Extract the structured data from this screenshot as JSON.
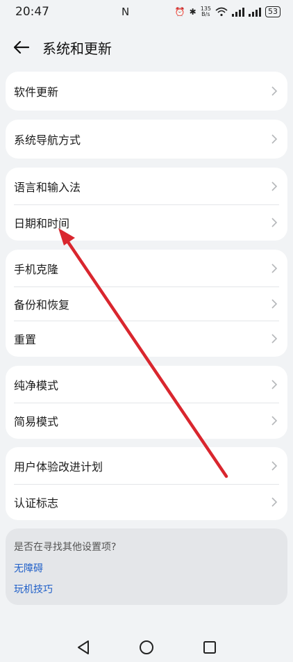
{
  "status_bar": {
    "time": "20:47",
    "nfc": "N",
    "net_speed_value": "135",
    "net_speed_unit": "B/s",
    "battery": "53"
  },
  "header": {
    "title": "系统和更新"
  },
  "groups": [
    {
      "items": [
        {
          "label": "软件更新"
        }
      ]
    },
    {
      "items": [
        {
          "label": "系统导航方式"
        }
      ]
    },
    {
      "items": [
        {
          "label": "语言和输入法"
        },
        {
          "label": "日期和时间"
        }
      ]
    },
    {
      "items": [
        {
          "label": "手机克隆"
        },
        {
          "label": "备份和恢复"
        },
        {
          "label": "重置"
        }
      ]
    },
    {
      "items": [
        {
          "label": "纯净模式"
        },
        {
          "label": "简易模式"
        }
      ]
    },
    {
      "items": [
        {
          "label": "用户体验改进计划"
        },
        {
          "label": "认证标志"
        }
      ]
    }
  ],
  "hint": {
    "title": "是否在寻找其他设置项?",
    "links": [
      {
        "label": "无障碍"
      },
      {
        "label": "玩机技巧"
      }
    ]
  },
  "colors": {
    "background": "#f1f3f5",
    "card": "#ffffff",
    "link": "#1f5fc8",
    "annotation_arrow": "#d9262e"
  }
}
